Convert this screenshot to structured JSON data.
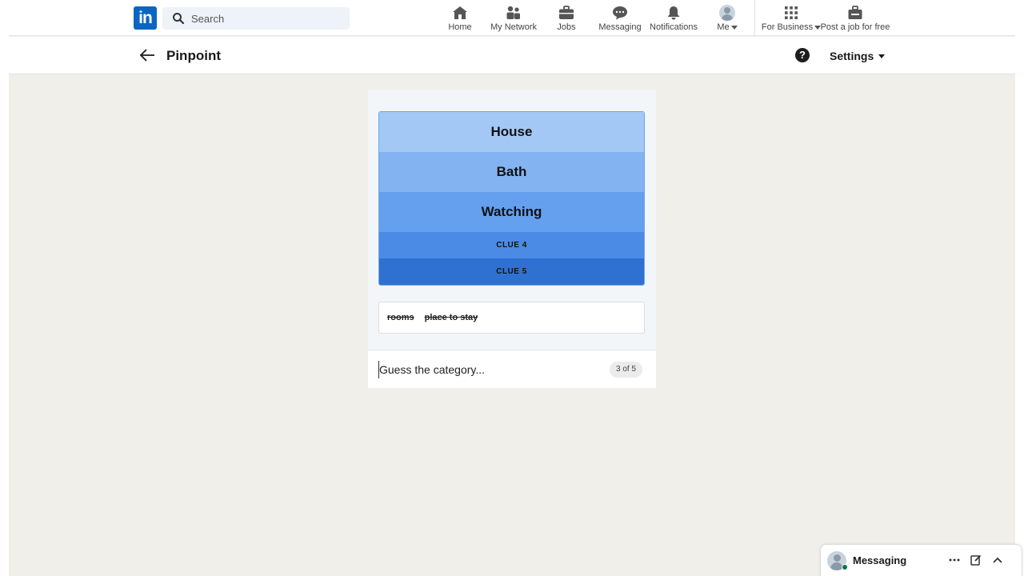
{
  "nav": {
    "logo": "in",
    "search_placeholder": "Search",
    "items": [
      {
        "label": "Home"
      },
      {
        "label": "My Network"
      },
      {
        "label": "Jobs"
      },
      {
        "label": "Messaging"
      },
      {
        "label": "Notifications"
      },
      {
        "label": "Me"
      },
      {
        "label": "For Business"
      },
      {
        "label": "Post a job for free"
      }
    ]
  },
  "header": {
    "title": "Pinpoint",
    "help": "?",
    "settings_label": "Settings"
  },
  "game": {
    "clues": [
      {
        "text": "House",
        "color": "#a3c8f6"
      },
      {
        "text": "Bath",
        "color": "#84b3f1"
      },
      {
        "text": "Watching",
        "color": "#64a0ee"
      },
      {
        "text": "CLUE 4",
        "color": "#4b8be6"
      },
      {
        "text": "CLUE 5",
        "color": "#2f71d1"
      }
    ],
    "previous_guesses": [
      "rooms",
      "place to stay"
    ],
    "input_placeholder": "Guess the category...",
    "guess_counter": "3 of 5"
  },
  "messaging": {
    "title": "Messaging"
  }
}
